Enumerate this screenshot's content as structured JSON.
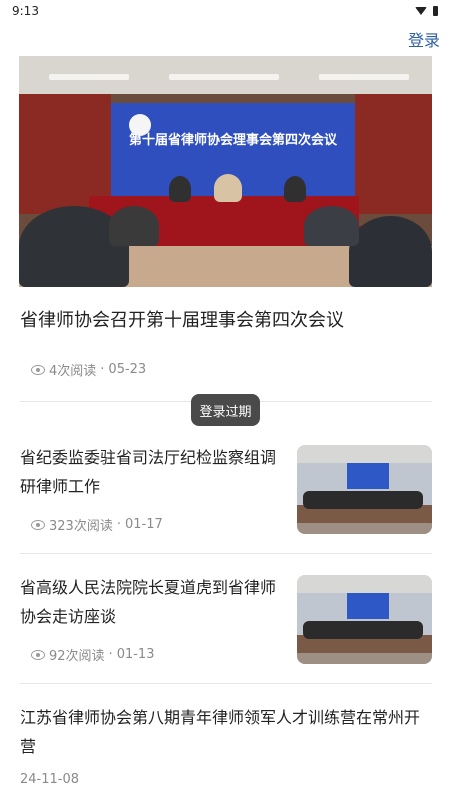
{
  "statusbar": {
    "time": "9:13"
  },
  "header": {
    "login_label": "登录"
  },
  "featured": {
    "title": "省律师协会召开第十届理事会第四次会议",
    "reads": "4次阅读",
    "separator": "·",
    "date": "05-23",
    "screen_title": "第十届省律师协会理事会第四次会议"
  },
  "toast": {
    "text": "登录过期"
  },
  "news": [
    {
      "title": "省纪委监委驻省司法厅纪检监察组调研律师工作",
      "reads": "323次阅读",
      "separator": "·",
      "date": "01-17"
    },
    {
      "title": "省高级人民法院院长夏道虎到省律师协会走访座谈",
      "reads": "92次阅读",
      "separator": "·",
      "date": "01-13"
    },
    {
      "title": "江苏省律师协会第八期青年律师领军人才训练营在常州开营",
      "date": "24-11-08"
    }
  ],
  "colors": {
    "link": "#2f5fa8",
    "meta": "#8a8a8a",
    "toast_bg": "#4a4a4a"
  }
}
